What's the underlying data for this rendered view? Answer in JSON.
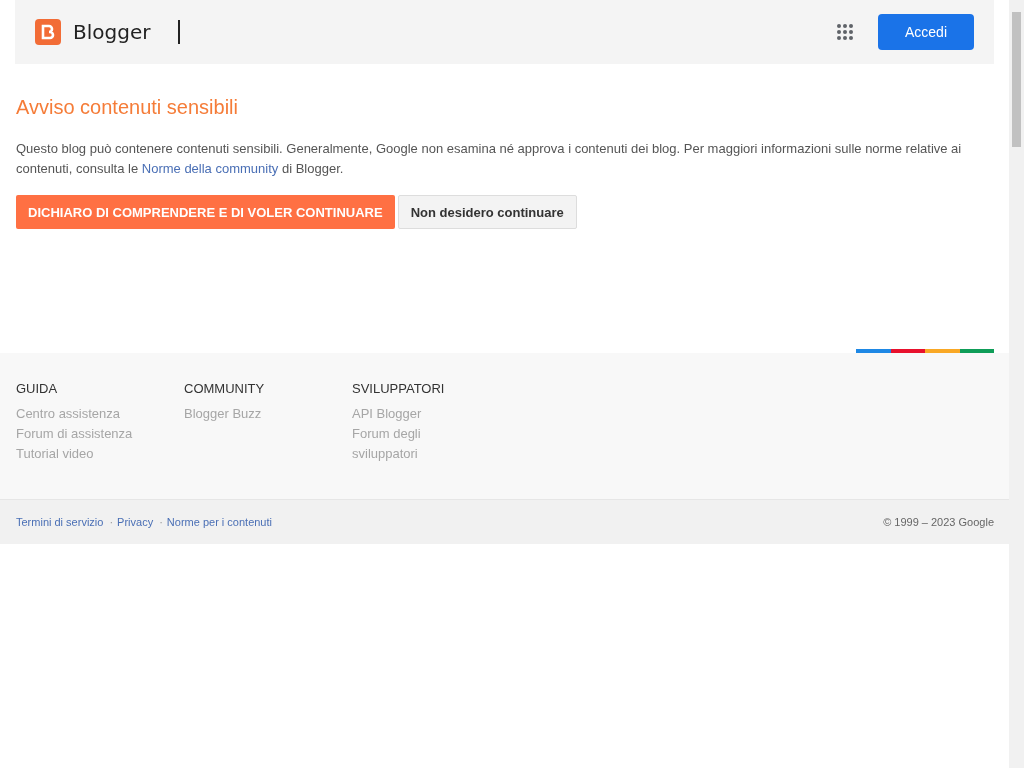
{
  "header": {
    "logo_text": "Blogger",
    "signin_button": "Accedi"
  },
  "warning": {
    "title": "Avviso contenuti sensibili",
    "text_before": "Questo blog può contenere contenuti sensibili. Generalmente, Google non esamina né approva i contenuti dei blog. Per maggiori informazioni sulle norme relative ai contenuti, consulta le",
    "link": "Norme della community",
    "text_after": "di Blogger.",
    "buttons": [
      {
        "label": "DICHIARO DI COMPRENDERE E DI VOLER CONTINUARE",
        "kind": "primary"
      },
      {
        "label": "Non desidero continuare",
        "kind": "secondary"
      }
    ]
  },
  "footer": {
    "columns": [
      {
        "heading": "GUIDA",
        "links": [
          "Centro assistenza",
          "Forum di assistenza",
          "Tutorial video"
        ]
      },
      {
        "heading": "COMMUNITY",
        "links": [
          "Blogger Buzz"
        ]
      },
      {
        "heading": "SVILUPPATORI",
        "links": [
          "API Blogger",
          "Forum degli sviluppatori"
        ]
      }
    ],
    "bottom_links": [
      "Termini di servizio",
      "Privacy",
      "Norme per i contenuti"
    ],
    "separator": "·",
    "copyright": "© 1999 – 2023 Google"
  }
}
